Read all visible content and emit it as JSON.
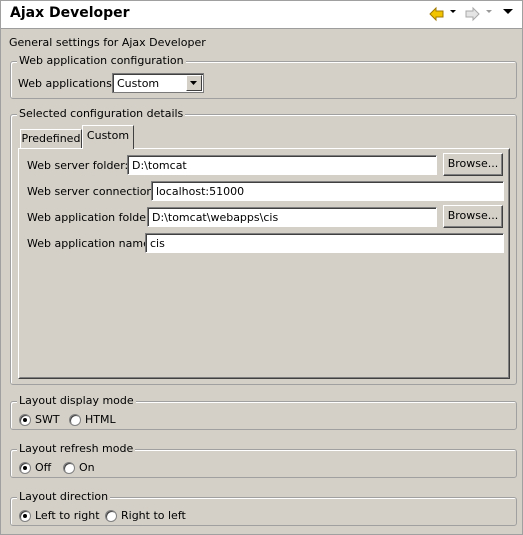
{
  "header": {
    "title": "Ajax Developer",
    "icons": [
      "back-icon",
      "back-menu-icon",
      "forward-icon",
      "forward-menu-icon",
      "view-menu-icon"
    ]
  },
  "description": "General settings for Ajax Developer",
  "web_app_config": {
    "legend": "Web application configuration",
    "label": "Web applications:",
    "selected": "Custom"
  },
  "details": {
    "legend": "Selected configuration details",
    "tabs": [
      {
        "label": "Predefined",
        "active": false
      },
      {
        "label": "Custom",
        "active": true
      }
    ],
    "fields": {
      "server_folder": {
        "label": "Web server folder:",
        "value": "D:\\tomcat",
        "browse": "Browse..."
      },
      "server_connection": {
        "label": "Web server connection:",
        "value": "localhost:51000"
      },
      "app_folder": {
        "label": "Web application folder:",
        "value": "D:\\tomcat\\webapps\\cis",
        "browse": "Browse..."
      },
      "app_name": {
        "label": "Web application name:",
        "value": "cis"
      }
    }
  },
  "display_mode": {
    "legend": "Layout display mode",
    "options": [
      {
        "label": "SWT",
        "selected": true
      },
      {
        "label": "HTML",
        "selected": false
      }
    ]
  },
  "refresh_mode": {
    "legend": "Layout refresh mode",
    "options": [
      {
        "label": "Off",
        "selected": true
      },
      {
        "label": "On",
        "selected": false
      }
    ]
  },
  "direction": {
    "legend": "Layout direction",
    "options": [
      {
        "label": "Left to right",
        "selected": true
      },
      {
        "label": "Right to left",
        "selected": false
      }
    ]
  },
  "colors": {
    "background": "#d4d0c8",
    "header": "#ffffff",
    "back_arrow": "#e8b800"
  }
}
